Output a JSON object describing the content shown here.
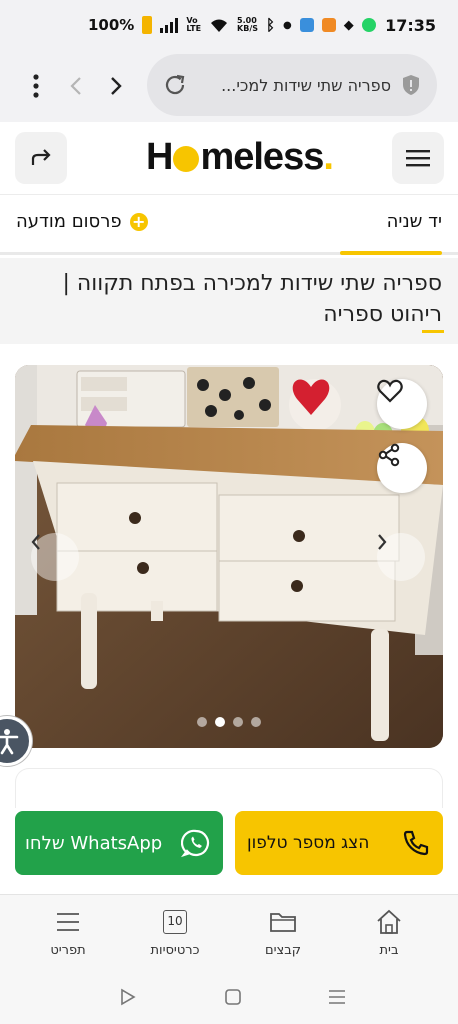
{
  "status_bar": {
    "battery_pct": "100%",
    "speed_value": "5.00",
    "speed_unit": "KB/S",
    "volte_top": "Vo",
    "volte_bottom": "LTE",
    "time": "17:35"
  },
  "browser": {
    "url_text": "ספריה שתי שידות למכי...",
    "back_icon": "chevron-left-icon",
    "forward_icon": "chevron-right-icon",
    "menu_icon": "more-vert-icon",
    "reload_icon": "reload-icon"
  },
  "header": {
    "logo_pre": "H",
    "logo_post": "meless",
    "logo_dot": ".",
    "brand_color": "#f7c500"
  },
  "category": {
    "label": "יד שניה",
    "post_ad_label": "פרסום מודעה",
    "post_ad_plus": "+"
  },
  "listing": {
    "title": "ספריה שתי שידות למכירה בפתח תקווה | ריהוט ספריה"
  },
  "gallery": {
    "image_count": 4,
    "active_index": 1
  },
  "actions": {
    "whatsapp_label": "שלחו WhatsApp",
    "phone_label": "הצג מספר טלפון",
    "whatsapp_color": "#22a24a"
  },
  "bottom_nav": {
    "items": [
      {
        "label": "בית",
        "icon": "home-icon"
      },
      {
        "label": "קבצים",
        "icon": "folder-icon"
      },
      {
        "label": "כרטיסיות",
        "icon": "tabs-icon",
        "badge": "10"
      },
      {
        "label": "תפריט",
        "icon": "menu-icon"
      }
    ]
  }
}
